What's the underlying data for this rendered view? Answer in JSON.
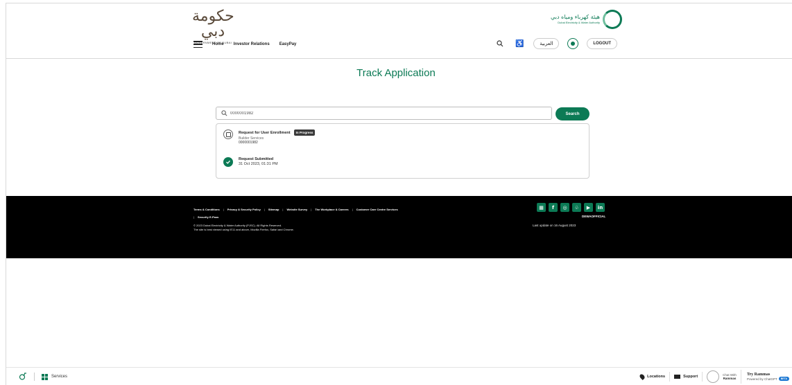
{
  "header": {
    "gov_logo_script": "حكومة دبي",
    "gov_logo_caption": "GOVERNMENT OF DUBAI",
    "dewa_logo_arabic": "هيئة كهرباء ومياه دبي",
    "dewa_logo_english": "Dubai Electricity & Water Authority",
    "nav": [
      "Home",
      "Investor Relations",
      "EasyPay"
    ],
    "language_label": "العربية",
    "logout_label": "LOGOUT"
  },
  "page": {
    "title": "Track Application"
  },
  "search": {
    "value": "0000001982",
    "button_label": "Search"
  },
  "result": {
    "request_title": "Request for User Enrollment",
    "status_badge": "In Progress",
    "category": "Builder Services",
    "request_number": "0000001982",
    "submitted_label": "Request Submitted",
    "submitted_date": "31 Oct 2023, 01:31 PM"
  },
  "footer": {
    "links": [
      "Terms & Conditions",
      "Privacy & Security Policy",
      "Sitemap",
      "Website Survey",
      "The Workplace & Careers",
      "Customer Care Centre Services",
      "Security E-Pass"
    ],
    "copyright": "© 2023 Dubai Electricity & Water Authority (PJSC). All Rights Reserved.",
    "browser_note": "The site is best viewed using IE11 and above, Mozilla Firefox, Safari and Chrome.",
    "social_icons": [
      "app-icon",
      "facebook-icon",
      "instagram-icon",
      "snapchat-icon",
      "youtube-icon",
      "linkedin-icon"
    ],
    "social_handle": "DEWAOFFICIAL",
    "last_update": "Last update on 16 August 2023"
  },
  "bottom_bar": {
    "services_label": "Services",
    "locations_label": "Locations",
    "support_label": "Support",
    "chat_line1": "Chat With",
    "chat_line2": "Rammas",
    "try_title": "Try Rammas",
    "try_sub": "Powered by ChatGPT",
    "beta_label": "BETA"
  },
  "colors": {
    "brand_green": "#0c7a55",
    "footer_bg": "#000000",
    "badge_bg": "#3a3a3a"
  }
}
